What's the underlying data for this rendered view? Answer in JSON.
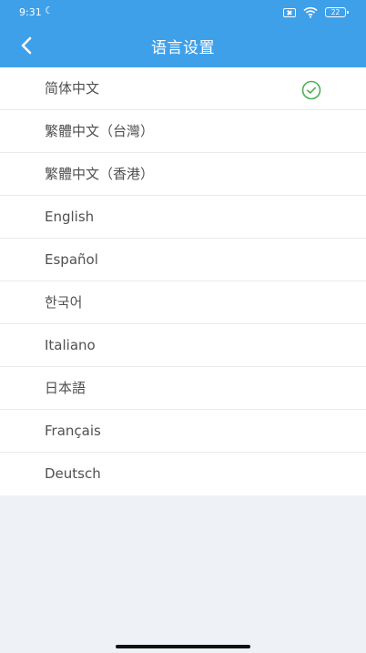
{
  "status_bar": {
    "time": "9:31",
    "battery": "22"
  },
  "header": {
    "title": "语言设置"
  },
  "languages": [
    {
      "label": "简体中文",
      "selected": true
    },
    {
      "label": "繁體中文（台灣）",
      "selected": false
    },
    {
      "label": "繁體中文（香港）",
      "selected": false
    },
    {
      "label": "English",
      "selected": false
    },
    {
      "label": "Español",
      "selected": false
    },
    {
      "label": "한국어",
      "selected": false
    },
    {
      "label": "Italiano",
      "selected": false
    },
    {
      "label": "日本語",
      "selected": false
    },
    {
      "label": "Français",
      "selected": false
    },
    {
      "label": "Deutsch",
      "selected": false
    }
  ],
  "colors": {
    "app_bar": "#3fa0ea",
    "check": "#4caf50",
    "background": "#eef1f5"
  },
  "icons": {
    "back": "chevron-left-icon",
    "selected": "check-circle-icon",
    "status_moon": "moon-icon",
    "status_sim": "sim-icon",
    "status_wifi": "wifi-icon",
    "status_battery": "battery-icon"
  }
}
